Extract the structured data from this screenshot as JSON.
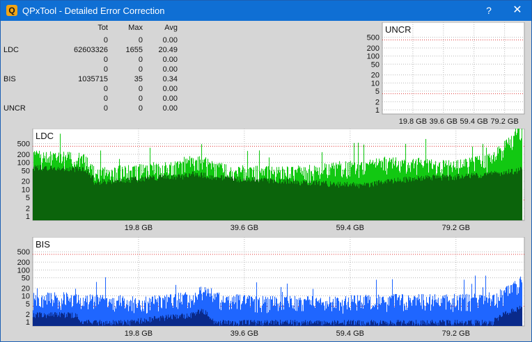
{
  "window": {
    "title": "QPxTool - Detailed Error Correction",
    "app_icon": "Q",
    "help_label": "?",
    "close_label": "✕"
  },
  "stats": {
    "headers": [
      "Tot",
      "Max",
      "Avg"
    ],
    "rows": [
      {
        "label": "",
        "tot": "0",
        "max": "0",
        "avg": "0.00"
      },
      {
        "label": "LDC",
        "tot": "62603326",
        "max": "1655",
        "avg": "20.49"
      },
      {
        "label": "",
        "tot": "0",
        "max": "0",
        "avg": "0.00"
      },
      {
        "label": "",
        "tot": "0",
        "max": "0",
        "avg": "0.00"
      },
      {
        "label": "BIS",
        "tot": "1035715",
        "max": "35",
        "avg": "0.34"
      },
      {
        "label": "",
        "tot": "0",
        "max": "0",
        "avg": "0.00"
      },
      {
        "label": "",
        "tot": "0",
        "max": "0",
        "avg": "0.00"
      },
      {
        "label": "UNCR",
        "tot": "0",
        "max": "0",
        "avg": "0.00"
      }
    ]
  },
  "colors": {
    "ldc_bright": "#12c812",
    "ldc_dark": "#0b640b",
    "bis_bright": "#1f66ff",
    "bis_dark": "#0a2a8a",
    "red_line": "#e03030"
  },
  "chart_data": [
    {
      "type": "area",
      "title": "UNCR",
      "y_scale": "log",
      "y_ticks": [
        "500",
        "200",
        "100",
        "50",
        "20",
        "10",
        "5",
        "2",
        "1"
      ],
      "x_ticks": [
        "19.8 GB",
        "39.6 GB",
        "59.4 GB",
        "79.2 GB"
      ],
      "xlim": [
        0,
        92
      ],
      "series": [
        {
          "x": [
            0,
            92
          ],
          "values": [
            0,
            0
          ]
        }
      ]
    },
    {
      "type": "area",
      "title": "LDC",
      "y_scale": "log",
      "y_ticks": [
        "500",
        "200",
        "100",
        "50",
        "20",
        "10",
        "5",
        "2",
        "1"
      ],
      "x_ticks": [
        "19.8 GB",
        "39.6 GB",
        "59.4 GB",
        "79.2 GB"
      ],
      "xlim": [
        0,
        92
      ],
      "series": [
        {
          "x": [
            0,
            4,
            8,
            10,
            11.5,
            14,
            18,
            20,
            24,
            28,
            30,
            34,
            38,
            42,
            46,
            50,
            54,
            58,
            62,
            66,
            70,
            74,
            78,
            82,
            86,
            88,
            90,
            91.5
          ],
          "values": [
            140,
            130,
            120,
            115,
            30,
            35,
            40,
            45,
            55,
            60,
            110,
            55,
            40,
            38,
            35,
            40,
            45,
            60,
            55,
            90,
            70,
            80,
            60,
            80,
            110,
            300,
            600,
            1655
          ]
        },
        {
          "x": [
            0,
            4,
            8,
            10,
            11.5,
            14,
            18,
            20,
            24,
            28,
            30,
            34,
            38,
            42,
            46,
            50,
            54,
            58,
            62,
            66,
            70,
            74,
            78,
            82,
            86,
            88,
            90,
            91.5
          ],
          "values": [
            70,
            65,
            60,
            58,
            20,
            22,
            24,
            26,
            30,
            32,
            40,
            30,
            26,
            24,
            22,
            20,
            18,
            16,
            15,
            20,
            25,
            30,
            30,
            35,
            40,
            45,
            50,
            60
          ]
        }
      ]
    },
    {
      "type": "area",
      "title": "BIS",
      "y_scale": "log",
      "y_ticks": [
        "500",
        "200",
        "100",
        "50",
        "20",
        "10",
        "5",
        "2",
        "1"
      ],
      "x_ticks": [
        "19.8 GB",
        "39.6 GB",
        "59.4 GB",
        "79.2 GB"
      ],
      "xlim": [
        0,
        92
      ],
      "series": [
        {
          "x": [
            0,
            4,
            8,
            10,
            14,
            18,
            22,
            26,
            30,
            31.5,
            34,
            38,
            42,
            46,
            50,
            54,
            58,
            62,
            66,
            70,
            74,
            78,
            82,
            86,
            88,
            90,
            91.5
          ],
          "values": [
            7,
            7,
            7,
            7,
            5,
            5,
            5,
            6,
            8,
            13,
            7,
            6,
            5,
            5,
            5,
            5,
            5,
            6,
            6,
            6,
            6,
            6,
            6,
            7,
            10,
            18,
            35
          ]
        },
        {
          "x": [
            0,
            8,
            9,
            18,
            30,
            31.5,
            34,
            50,
            70,
            86,
            88,
            90,
            91.5
          ],
          "values": [
            2,
            2,
            1,
            1,
            2,
            3,
            1,
            1,
            1,
            1,
            2,
            3,
            4
          ]
        }
      ]
    }
  ]
}
